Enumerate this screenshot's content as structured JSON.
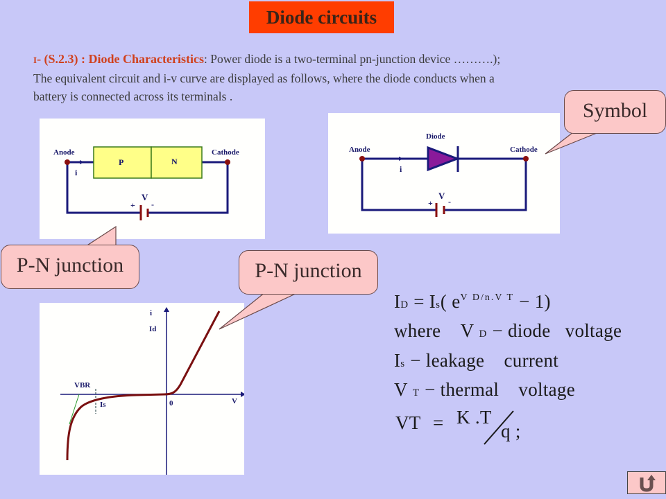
{
  "header": {
    "title": "Diode circuits"
  },
  "intro": {
    "prefix_roman": "I",
    "section_ref": "- (S.2.3) : Diode Characteristics",
    "line1_rest": ": Power diode is a two-terminal pn-junction device ……….);",
    "line2": "The  equivalent circuit and i-v curve are displayed as follows, where the diode conducts when  a",
    "line3": "battery is connected  across its terminals ."
  },
  "pn_diagram": {
    "anode_label": "Anode",
    "cathode_label": "Cathode",
    "p_label": "P",
    "n_label": "N",
    "current_label": "i",
    "voltage_label": "V",
    "plus": "+",
    "minus": "-",
    "colors": {
      "wire": "#1a1a7a",
      "junction_fill": "#ffff88",
      "junction_border": "#3a7a1a",
      "terminal": "#8a1010",
      "battery": "#8a1010"
    }
  },
  "symbol_diagram": {
    "diode_label": "Diode",
    "anode_label": "Anode",
    "cathode_label": "Cathode",
    "current_label": "i",
    "voltage_label": "V",
    "plus": "+",
    "minus": "-",
    "colors": {
      "wire": "#1a1a7a",
      "diode_fill": "#8a1a9a",
      "terminal": "#8a1010"
    }
  },
  "callouts": {
    "symbol": "Symbol",
    "pn_junction_1": "P-N junction",
    "pn_junction_2": "P-N junction"
  },
  "iv_curve": {
    "y_axis_label": "i",
    "id_label": "Id",
    "vbr_label": "VBR",
    "is_label": "Is",
    "origin_label": "0",
    "x_axis_label": "V",
    "colors": {
      "axis": "#1a1a7a",
      "curve": "#7a1010",
      "vbr_line": "#2a9a2a"
    }
  },
  "equations": {
    "line1": {
      "lhs": "I",
      "lhs_sub": "D",
      "eq": " = I",
      "is_sub": "s",
      "open": "( e",
      "exp": "V D/n.V T",
      "tail": " − 1)"
    },
    "line2": {
      "where": "where",
      "v": "V",
      "v_sub": "D",
      "desc": " − diode   voltage"
    },
    "line3": {
      "i": "I",
      "i_sub": "s",
      "desc": " − leakage    current"
    },
    "line4": {
      "v": "V",
      "v_sub": "T",
      "desc": " − thermal    voltage"
    },
    "line5": {
      "lhs": "VT",
      "eq": "=",
      "num": "K .T",
      "den": "q ;"
    }
  },
  "nav": {
    "return_icon": "return-arrow-icon"
  }
}
